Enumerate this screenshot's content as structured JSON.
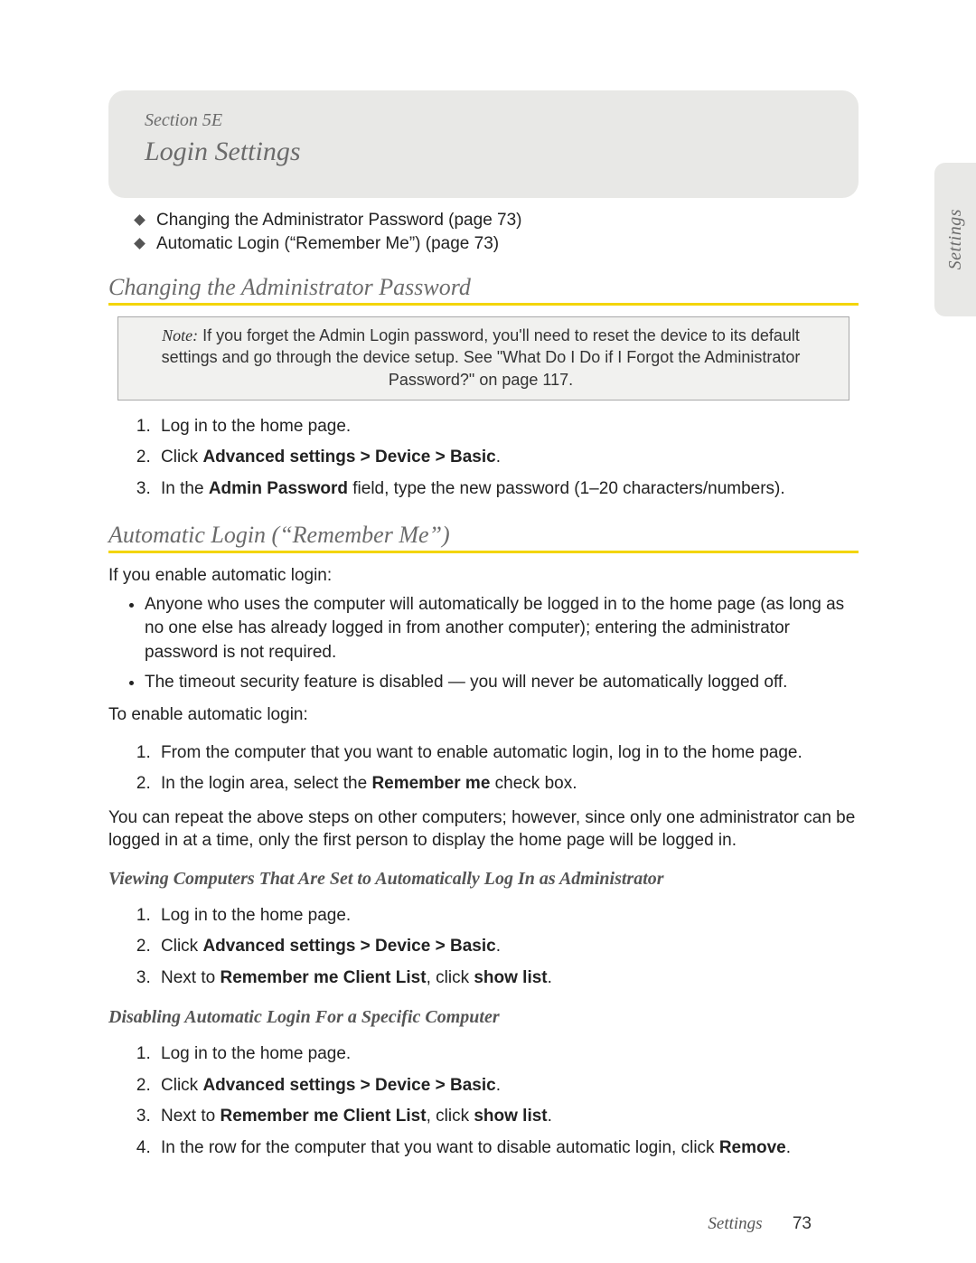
{
  "tab_label": "Settings",
  "header": {
    "section_label": "Section 5E",
    "title": "Login Settings"
  },
  "toc": [
    "Changing the Administrator Password (page 73)",
    "Automatic Login (“Remember Me”) (page 73)"
  ],
  "s1": {
    "heading": "Changing the Administrator Password",
    "note_label": "Note:",
    "note_text": " If you forget the Admin Login password, you'll need to reset the device to its default settings and go through the device setup. See \"What Do I Do if I Forgot the Administrator Password?\" on page 117.",
    "step1": "Log in to the home page.",
    "step2_pre": "Click ",
    "step2_b1": "Advanced settings",
    "step2_gt1": " > ",
    "step2_b2": "Device",
    "step2_gt2": " > ",
    "step2_b3": "Basic",
    "step2_end": ".",
    "step3_pre": "In the ",
    "step3_b": "Admin Password",
    "step3_post": " field, type the new password (1–20 characters/numbers)."
  },
  "s2": {
    "heading": "Automatic Login (“Remember Me”)",
    "intro": "If you enable automatic login:",
    "b1": "Anyone who uses the computer will automatically be logged in to the home page (as long as no one else has already logged in from another computer); entering the administrator password is not required.",
    "b2": "The timeout security feature is disabled — you will never be automatically logged off.",
    "enable_intro": "To enable automatic login:",
    "e1": "From the computer that you want to enable automatic login, log in to the home page.",
    "e2_pre": "In the login area, select the ",
    "e2_b": "Remember me",
    "e2_post": " check box.",
    "repeat": "You can repeat the above steps on other computers; however, since only one administrator can be logged in at a time, only the first person to display the home page will be logged in.",
    "view_h": "Viewing Computers That Are Set to Automatically Log In as Administrator",
    "v1": "Log in to the home page.",
    "v3_pre": "Next to ",
    "v3_b1": "Remember me Client List",
    "v3_mid": ", click ",
    "v3_b2": "show list",
    "v3_end": ".",
    "disable_h": "Disabling Automatic Login For a Specific Computer",
    "d4_pre": "In the row for the computer that you want to disable automatic login, click ",
    "d4_b": "Remove",
    "d4_end": "."
  },
  "footer": {
    "category": "Settings",
    "page": "73"
  }
}
